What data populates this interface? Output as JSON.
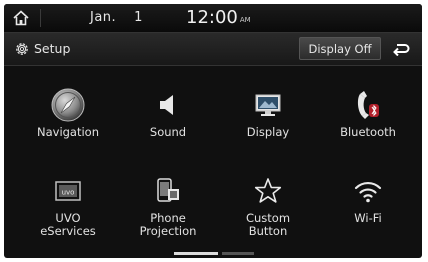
{
  "status_bar": {
    "month": "Jan.",
    "day": "1",
    "time": "12:00",
    "ampm": "AM"
  },
  "header": {
    "title": "Setup",
    "display_off_label": "Display Off"
  },
  "menu": [
    {
      "label": "Navigation",
      "icon": "navigation-icon"
    },
    {
      "label": "Sound",
      "icon": "speaker-icon"
    },
    {
      "label": "Display",
      "icon": "monitor-icon"
    },
    {
      "label": "Bluetooth",
      "icon": "bluetooth-phone-icon"
    },
    {
      "label_line1": "UVO",
      "label_line2": "eServices",
      "icon": "uvo-icon"
    },
    {
      "label_line1": "Phone",
      "label_line2": "Projection",
      "icon": "phone-projection-icon"
    },
    {
      "label_line1": "Custom",
      "label_line2": "Button",
      "icon": "star-icon"
    },
    {
      "label": "Wi-Fi",
      "icon": "wifi-icon"
    }
  ],
  "pagination": {
    "pages": 2,
    "current": 1
  }
}
